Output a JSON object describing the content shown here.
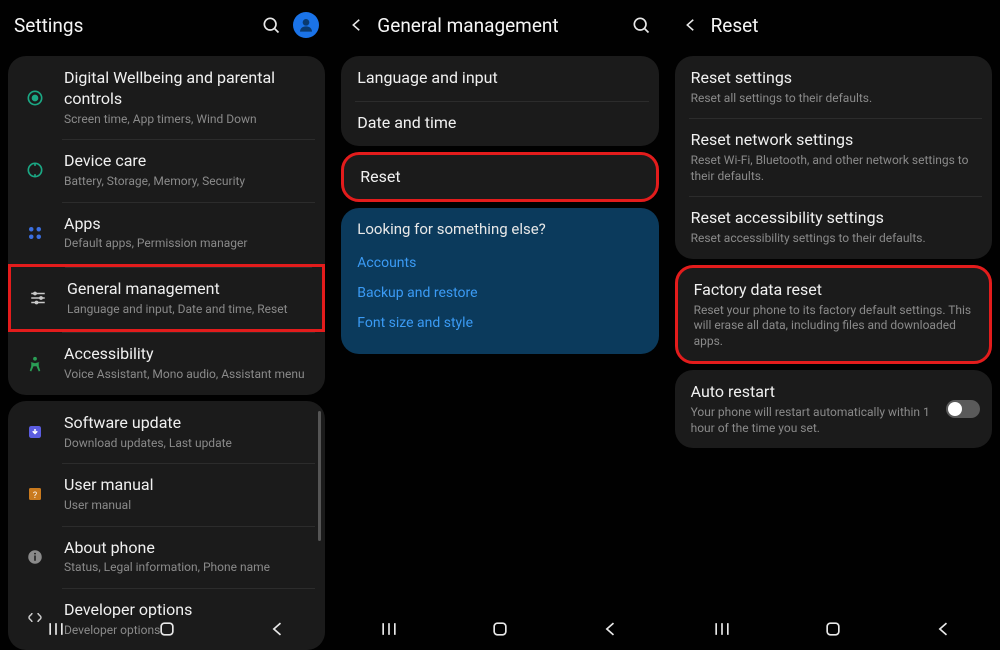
{
  "screen1": {
    "header": {
      "title": "Settings"
    },
    "group1": [
      {
        "title": "Digital Wellbeing and parental controls",
        "sub": "Screen time, App timers, Wind Down",
        "icon": "wellbeing-icon"
      },
      {
        "title": "Device care",
        "sub": "Battery, Storage, Memory, Security",
        "icon": "devicecare-icon"
      },
      {
        "title": "Apps",
        "sub": "Default apps, Permission manager",
        "icon": "apps-icon"
      },
      {
        "title": "General management",
        "sub": "Language and input, Date and time, Reset",
        "icon": "general-icon",
        "highlight": true
      },
      {
        "title": "Accessibility",
        "sub": "Voice Assistant, Mono audio, Assistant menu",
        "icon": "accessibility-icon"
      }
    ],
    "group2": [
      {
        "title": "Software update",
        "sub": "Download updates, Last update",
        "icon": "update-icon"
      },
      {
        "title": "User manual",
        "sub": "User manual",
        "icon": "manual-icon"
      },
      {
        "title": "About phone",
        "sub": "Status, Legal information, Phone name",
        "icon": "about-icon"
      },
      {
        "title": "Developer options",
        "sub": "Developer options",
        "icon": "dev-icon"
      }
    ]
  },
  "screen2": {
    "header": {
      "title": "General management"
    },
    "group1": [
      {
        "title": "Language and input"
      },
      {
        "title": "Date and time"
      }
    ],
    "reset": {
      "title": "Reset"
    },
    "looking": {
      "heading": "Looking for something else?",
      "links": [
        "Accounts",
        "Backup and restore",
        "Font size and style"
      ]
    }
  },
  "screen3": {
    "header": {
      "title": "Reset"
    },
    "group1": [
      {
        "title": "Reset settings",
        "sub": "Reset all settings to their defaults."
      },
      {
        "title": "Reset network settings",
        "sub": "Reset Wi-Fi, Bluetooth, and other network settings to their defaults."
      },
      {
        "title": "Reset accessibility settings",
        "sub": "Reset accessibility settings to their defaults."
      }
    ],
    "factory": {
      "title": "Factory data reset",
      "sub": "Reset your phone to its factory default settings. This will erase all data, including files and downloaded apps."
    },
    "auto": {
      "title": "Auto restart",
      "sub": "Your phone will restart automatically within 1 hour of the time you set."
    }
  }
}
